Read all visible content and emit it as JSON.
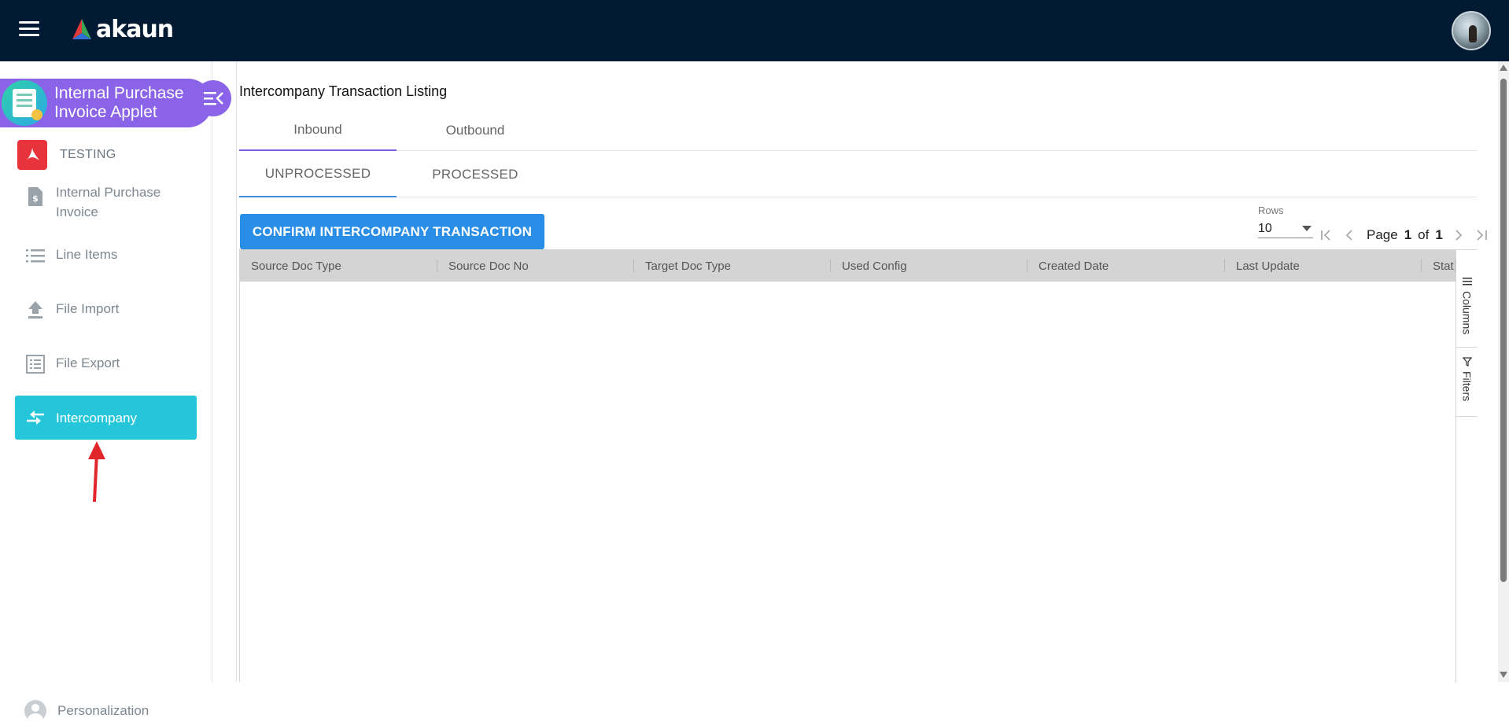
{
  "topbar": {
    "brand": "akaun",
    "menu_icon": "hamburger-icon",
    "avatar_icon": "user-avatar"
  },
  "sidebar": {
    "applet_title_line1": "Internal Purchase",
    "applet_title_line2": "Invoice Applet",
    "collapse_icon": "collapse-menu-icon",
    "company": "TESTING",
    "items": [
      {
        "label_line1": "Internal Purchase",
        "label_line2": "Invoice",
        "icon": "invoice-icon"
      },
      {
        "label": "Line Items",
        "icon": "list-icon"
      },
      {
        "label": "File Import",
        "icon": "upload-icon"
      },
      {
        "label": "File Export",
        "icon": "export-list-icon"
      },
      {
        "label": "Intercompany",
        "icon": "transfer-arrows-icon",
        "active": true
      }
    ],
    "personalization": "Personalization"
  },
  "main": {
    "title": "Intercompany Transaction Listing",
    "tabs": [
      {
        "label": "Inbound",
        "active": true
      },
      {
        "label": "Outbound",
        "active": false
      }
    ],
    "subtabs": [
      {
        "label": "UNPROCESSED",
        "active": true
      },
      {
        "label": "PROCESSED",
        "active": false
      }
    ],
    "confirm_button": "CONFIRM INTERCOMPANY TRANSACTION",
    "pagination": {
      "rows_label": "Rows",
      "rows_value": "10",
      "page_label": "Page",
      "page_current": "1",
      "of_label": "of",
      "page_total": "1"
    },
    "grid": {
      "columns": [
        "Source Doc Type",
        "Source Doc No",
        "Target Doc Type",
        "Used Config",
        "Created Date",
        "Last Update",
        "Stat"
      ],
      "rows": [],
      "side_tabs": [
        {
          "label": "Columns",
          "icon": "columns-icon"
        },
        {
          "label": "Filters",
          "icon": "filter-icon"
        }
      ]
    }
  },
  "colors": {
    "topbar": "#011a33",
    "applet_header": "#8a63e8",
    "active_nav": "#26c6da",
    "primary_button": "#2a8de6",
    "annotation_arrow": "#e0262b"
  }
}
